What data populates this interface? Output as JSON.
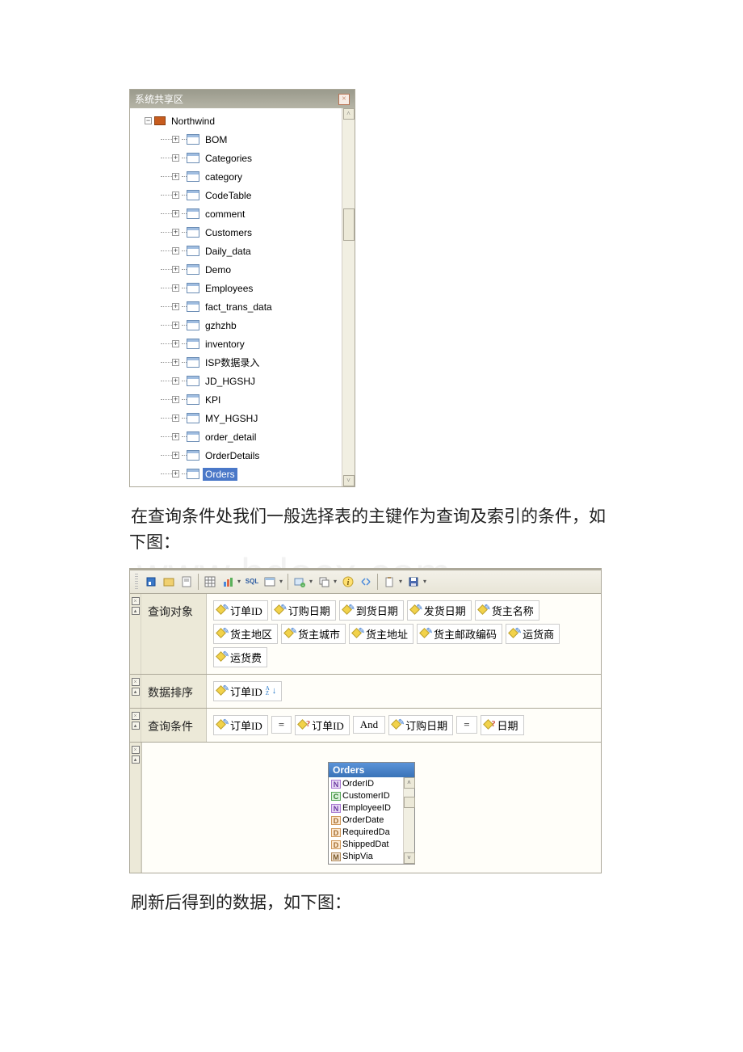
{
  "tree": {
    "title": "系统共享区",
    "root_label": "Northwind",
    "items": [
      {
        "label": "BOM"
      },
      {
        "label": "Categories"
      },
      {
        "label": "category"
      },
      {
        "label": "CodeTable"
      },
      {
        "label": "comment"
      },
      {
        "label": "Customers"
      },
      {
        "label": "Daily_data"
      },
      {
        "label": "Demo"
      },
      {
        "label": "Employees"
      },
      {
        "label": "fact_trans_data"
      },
      {
        "label": "gzhzhb"
      },
      {
        "label": "inventory"
      },
      {
        "label": "ISP数据录入"
      },
      {
        "label": "JD_HGSHJ"
      },
      {
        "label": "KPI"
      },
      {
        "label": "MY_HGSHJ"
      },
      {
        "label": "order_detail"
      },
      {
        "label": "OrderDetails"
      },
      {
        "label": "Orders",
        "selected": true
      }
    ]
  },
  "paragraphs": {
    "p1a": "在查询条件处我们一般选择表的主键作为查询及索引的条件，如",
    "p1b": "下图：",
    "p2": "刷新后得到的数据，如下图："
  },
  "designer": {
    "sections": {
      "query_object": "查询对象",
      "sort": "数据排序",
      "condition": "查询条件"
    },
    "query_object_chips": [
      "订单ID",
      "订购日期",
      "到货日期",
      "发货日期",
      "货主名称",
      "货主地区",
      "货主城市",
      "货主地址",
      "货主邮政编码",
      "运货商",
      "运货费"
    ],
    "sort_chips": [
      "订单ID"
    ],
    "condition": {
      "c0": "订单ID",
      "c1": "=",
      "c2": "订单ID",
      "c3": "And",
      "c4": "订购日期",
      "c5": "=",
      "c6": "日期"
    },
    "fields_box": {
      "title": "Orders",
      "fields": [
        {
          "type": "N",
          "name": "OrderID"
        },
        {
          "type": "C",
          "name": "CustomerID"
        },
        {
          "type": "N",
          "name": "EmployeeID"
        },
        {
          "type": "D",
          "name": "OrderDate"
        },
        {
          "type": "D",
          "name": "RequiredDa"
        },
        {
          "type": "D",
          "name": "ShippedDat"
        },
        {
          "type": "M",
          "name": "ShipVia"
        }
      ]
    }
  },
  "watermark": "www.bdocx.com"
}
